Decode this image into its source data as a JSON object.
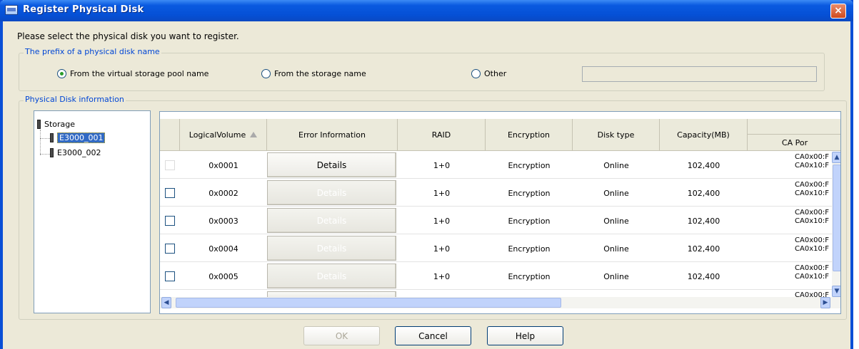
{
  "window": {
    "title": "Register Physical Disk",
    "close_glyph": "×"
  },
  "instruction": "Please select the physical disk you want to register.",
  "prefix_group": {
    "label": "The prefix of a physical disk name",
    "options": [
      {
        "label": "From the virtual storage pool name",
        "checked": true
      },
      {
        "label": "From the storage name",
        "checked": false
      },
      {
        "label": "Other",
        "checked": false
      }
    ],
    "other_value": ""
  },
  "info_group": {
    "label": "Physical Disk information"
  },
  "tree": {
    "root": "Storage",
    "children": [
      {
        "label": "E3000_001",
        "selected": true
      },
      {
        "label": "E3000_002",
        "selected": false
      }
    ]
  },
  "table": {
    "headers": {
      "logical_volume": "LogicalVolume",
      "error_information": "Error Information",
      "raid": "RAID",
      "encryption": "Encryption",
      "disk_type": "Disk type",
      "capacity": "Capacity(MB)",
      "ca_port": "CA Por"
    },
    "rows": [
      {
        "logical_volume": "0x0001",
        "details": "Details",
        "details_enabled": true,
        "raid": "1+0",
        "encryption": "Encryption",
        "disk_type": "Online",
        "capacity": "102,400",
        "ca_line1": "CA0x00:F",
        "ca_line2": "CA0x10:F",
        "checkbox_enabled": false
      },
      {
        "logical_volume": "0x0002",
        "details": "Details",
        "details_enabled": false,
        "raid": "1+0",
        "encryption": "Encryption",
        "disk_type": "Online",
        "capacity": "102,400",
        "ca_line1": "CA0x00:F",
        "ca_line2": "CA0x10:F",
        "checkbox_enabled": true
      },
      {
        "logical_volume": "0x0003",
        "details": "Details",
        "details_enabled": false,
        "raid": "1+0",
        "encryption": "Encryption",
        "disk_type": "Online",
        "capacity": "102,400",
        "ca_line1": "CA0x00:F",
        "ca_line2": "CA0x10:F",
        "checkbox_enabled": true
      },
      {
        "logical_volume": "0x0004",
        "details": "Details",
        "details_enabled": false,
        "raid": "1+0",
        "encryption": "Encryption",
        "disk_type": "Online",
        "capacity": "102,400",
        "ca_line1": "CA0x00:F",
        "ca_line2": "CA0x10:F",
        "checkbox_enabled": true
      },
      {
        "logical_volume": "0x0005",
        "details": "Details",
        "details_enabled": false,
        "raid": "1+0",
        "encryption": "Encryption",
        "disk_type": "Online",
        "capacity": "102,400",
        "ca_line1": "CA0x00:F",
        "ca_line2": "CA0x10:F",
        "checkbox_enabled": true
      }
    ],
    "partial_row_ca": "CA0x00:F"
  },
  "buttons": {
    "ok": "OK",
    "cancel": "Cancel",
    "help": "Help"
  },
  "scroll_glyphs": {
    "up": "▲",
    "down": "▼",
    "left": "◀",
    "right": "▶"
  }
}
